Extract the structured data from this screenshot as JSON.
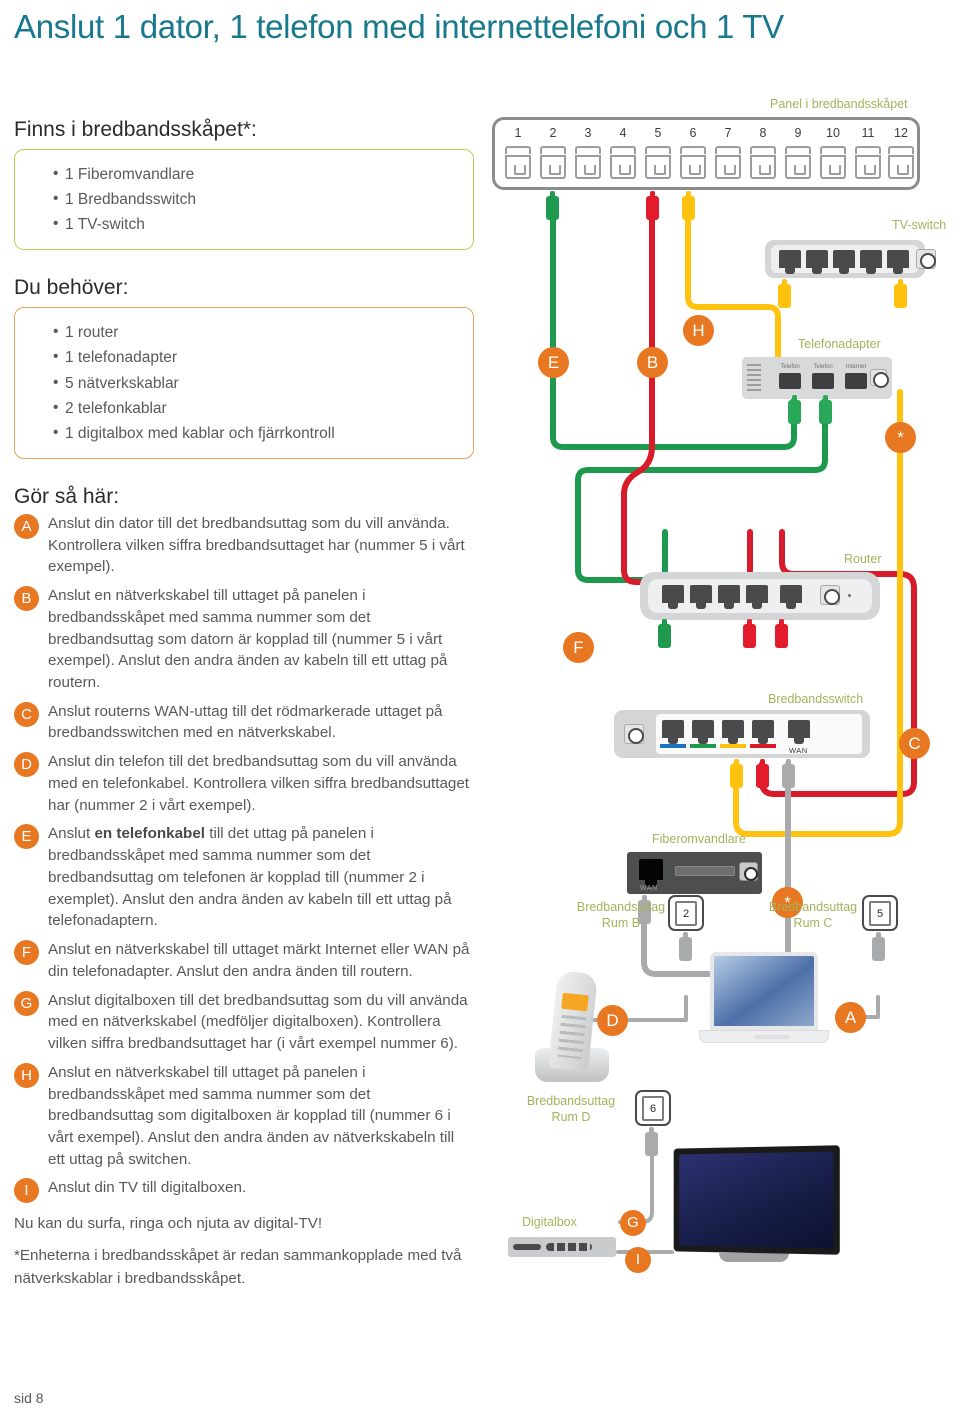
{
  "title": "Anslut 1 dator, 1 telefon med internettelefoni och 1 TV",
  "page_number": "sid 8",
  "accent_colors": {
    "title": "#18788c",
    "badge_orange": "#e87722",
    "label_olive": "#a6b25c",
    "cable_green": "#1d9a4e",
    "cable_red": "#d81b2a",
    "cable_yellow": "#ffc20e",
    "cable_gray": "#a8aaac",
    "box_green_border": "#b9cf5b",
    "box_orange_border": "#e8a55c"
  },
  "sections": {
    "cabinet": {
      "heading": "Finns i bredbandsskåpet*:",
      "items": [
        "1 Fiberomvandlare",
        "1 Bredbandsswitch",
        "1 TV-switch"
      ]
    },
    "need": {
      "heading": "Du behöver:",
      "items": [
        "1 router",
        "1 telefonadapter",
        "5 nätverkskablar",
        "2 telefonkablar",
        "1 digitalbox med kablar och fjärrkontroll"
      ]
    },
    "howto": {
      "heading": "Gör så här:",
      "steps": [
        {
          "letter": "A",
          "text": "Anslut din dator till det bredbandsuttag som du vill använda. Kontrollera vilken siffra bredbandsuttaget har (nummer 5 i vårt exempel)."
        },
        {
          "letter": "B",
          "text": "Anslut en nätverkskabel till uttaget på panelen i bredbandsskåpet med samma nummer som det bredbandsuttag som datorn är kopplad till (nummer 5 i vårt exempel). Anslut den andra änden av kabeln till ett uttag på routern."
        },
        {
          "letter": "C",
          "text": "Anslut routerns WAN-uttag till det rödmarkerade uttaget på bredbandsswitchen med en nätverkskabel."
        },
        {
          "letter": "D",
          "text": "Anslut din telefon till det bredbandsuttag som du vill använda med en telefonkabel. Kontrollera vilken siffra bredbandsuttaget har (nummer 2 i vårt exempel)."
        },
        {
          "letter": "E",
          "text_before": "Anslut ",
          "text_bold": "en telefonkabel",
          "text_after": " till det uttag på panelen i bredbandsskåpet med samma nummer som det bredbandsuttag om telefonen är kopplad till (nummer 2 i exemplet). Anslut den andra änden av kabeln till ett uttag på telefonadaptern."
        },
        {
          "letter": "F",
          "text": "Anslut en nätverkskabel till uttaget märkt Internet eller WAN på din telefonadapter. Anslut den andra änden till routern."
        },
        {
          "letter": "G",
          "text": "Anslut digitalboxen till det bredbandsuttag som du vill använda med en nätverkskabel (medföljer digitalboxen). Kontrollera vilken siffra bredbandsuttaget har (i vårt exempel nummer 6)."
        },
        {
          "letter": "H",
          "text": "Anslut en nätverkskabel till uttaget på panelen i bredbandsskåpet med samma nummer som det bredbandsuttag som digitalboxen är kopplad till (nummer 6 i vårt exempel).  Anslut den andra änden av nätverkskabeln till ett uttag på switchen."
        },
        {
          "letter": "I",
          "text": "Anslut din TV till digitalboxen."
        }
      ],
      "closing": "Nu kan du surfa, ringa  och njuta av digital-TV!",
      "footnote": "*Enheterna i bredbandsskåpet är redan sammankopplade med två nätverkskablar i bredbandsskåpet."
    }
  },
  "diagram": {
    "labels": {
      "panel": "Panel i bredbandsskåpet",
      "tv_switch": "TV-switch",
      "telefonadapter": "Telefonadapter",
      "router": "Router",
      "bredbandsswitch": "Bredbandsswitch",
      "fiberomvandlare": "Fiberomvandlare",
      "digitalbox": "Digitalbox",
      "outlet_b_line1": "Bredbandsuttag",
      "outlet_b_line2": "Rum B",
      "outlet_c_line1": "Bredbandsuttag",
      "outlet_c_line2": "Rum C",
      "outlet_d_line1": "Bredbandsuttag",
      "outlet_d_line2": "Rum D"
    },
    "panel_ports": [
      "1",
      "2",
      "3",
      "4",
      "5",
      "6",
      "7",
      "8",
      "9",
      "10",
      "11",
      "12"
    ],
    "outlet_numbers": {
      "room_b": "2",
      "room_c": "5",
      "room_d": "6"
    },
    "port_marks": {
      "wan_switch": "WAN",
      "wan_fiber": "WAN"
    },
    "adapter_ports": [
      "Telefon",
      "Telefon",
      "Internet"
    ],
    "markers": [
      "E",
      "B",
      "H",
      "F",
      "C",
      "*",
      "*",
      "D",
      "A",
      "G",
      "I"
    ],
    "asterisk": "*"
  }
}
